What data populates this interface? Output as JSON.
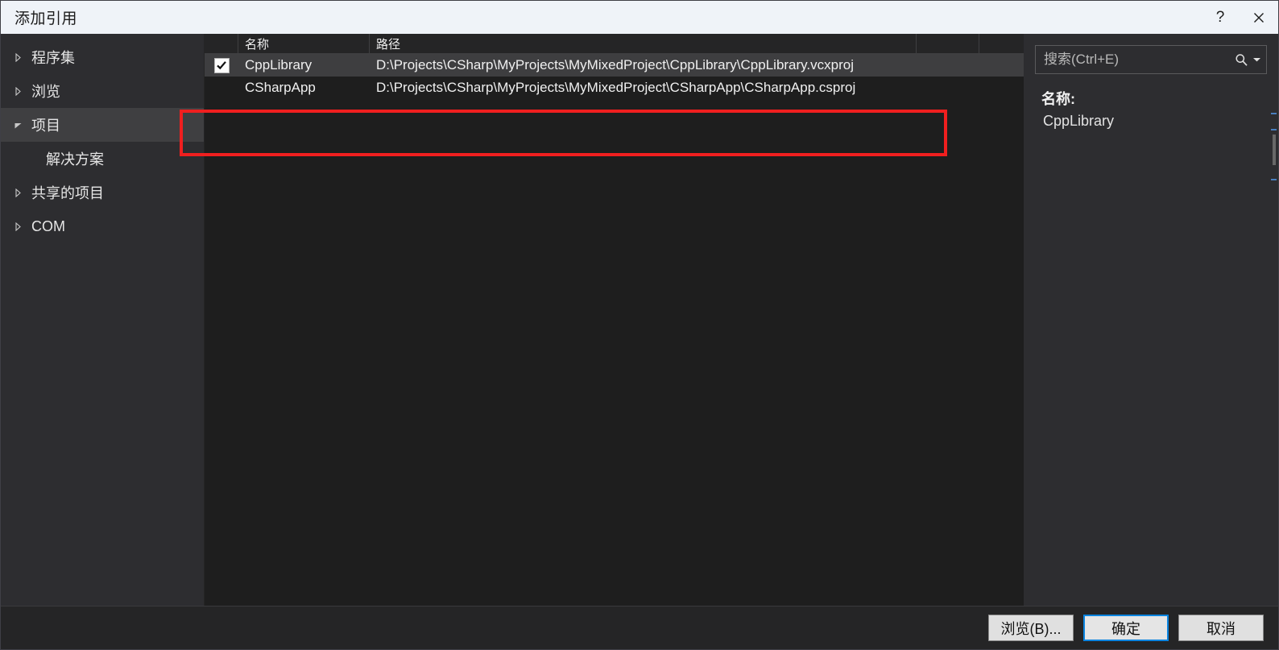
{
  "window": {
    "title": "添加引用",
    "help_button": "?",
    "close_button": "✕",
    "help_icon": "question-mark-icon",
    "close_icon": "close-icon"
  },
  "sidebar": {
    "items": [
      {
        "label": "程序集",
        "expandable": true,
        "expanded": false,
        "selected": false,
        "child": false
      },
      {
        "label": "浏览",
        "expandable": true,
        "expanded": false,
        "selected": false,
        "child": false
      },
      {
        "label": "项目",
        "expandable": true,
        "expanded": true,
        "selected": true,
        "child": false
      },
      {
        "label": "解决方案",
        "expandable": false,
        "expanded": false,
        "selected": false,
        "child": true
      },
      {
        "label": "共享的项目",
        "expandable": true,
        "expanded": false,
        "selected": false,
        "child": false
      },
      {
        "label": "COM",
        "expandable": true,
        "expanded": false,
        "selected": false,
        "child": false
      }
    ]
  },
  "grid": {
    "columns": [
      "",
      "名称",
      "路径",
      "",
      ""
    ],
    "rows": [
      {
        "checked": true,
        "selected": true,
        "name": "CppLibrary",
        "path": "D:\\Projects\\CSharp\\MyProjects\\MyMixedProject\\CppLibrary\\CppLibrary.vcxproj"
      },
      {
        "checked": false,
        "selected": false,
        "name": "CSharpApp",
        "path": "D:\\Projects\\CSharp\\MyProjects\\MyMixedProject\\CSharpApp\\CSharpApp.csproj"
      }
    ]
  },
  "search": {
    "placeholder": "搜索(Ctrl+E)",
    "value": "",
    "icon": "search-icon",
    "dropdown_icon": "chevron-down-icon"
  },
  "details": {
    "name_key": "名称:",
    "name_value": "CppLibrary"
  },
  "footer": {
    "browse_label": "浏览(B)...",
    "ok_label": "确定",
    "cancel_label": "取消"
  },
  "annotation": {
    "color": "#f01f1f",
    "shape": "rectangle-highlight"
  },
  "colors": {
    "titlebar_bg": "#eff3f8",
    "dialog_bg": "#2d2d30",
    "list_bg": "#1e1e1e",
    "selection_bg": "#3e3e40",
    "accent_blue": "#0a84e0",
    "annotation_red": "#f01f1f"
  }
}
